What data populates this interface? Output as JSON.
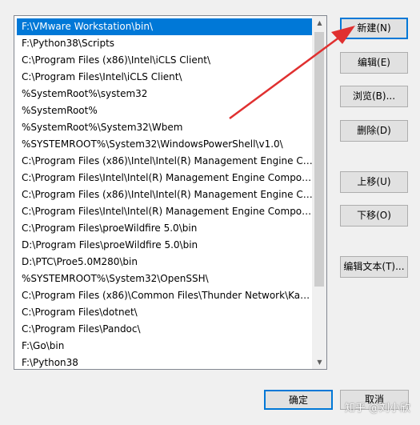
{
  "path_list": {
    "items": [
      "F:\\VMware Workstation\\bin\\",
      "F:\\Python38\\Scripts",
      "C:\\Program Files (x86)\\Intel\\iCLS Client\\",
      "C:\\Program Files\\Intel\\iCLS Client\\",
      "%SystemRoot%\\system32",
      "%SystemRoot%",
      "%SystemRoot%\\System32\\Wbem",
      "%SYSTEMROOT%\\System32\\WindowsPowerShell\\v1.0\\",
      "C:\\Program Files (x86)\\Intel\\Intel(R) Management Engine Co...",
      "C:\\Program Files\\Intel\\Intel(R) Management Engine Compon...",
      "C:\\Program Files (x86)\\Intel\\Intel(R) Management Engine Co...",
      "C:\\Program Files\\Intel\\Intel(R) Management Engine Compon...",
      "C:\\Program Files\\proeWildfire 5.0\\bin",
      "D:\\Program Files\\proeWildfire 5.0\\bin",
      "D:\\PTC\\Proe5.0M280\\bin",
      "%SYSTEMROOT%\\System32\\OpenSSH\\",
      "C:\\Program Files (x86)\\Common Files\\Thunder Network\\Kan...",
      "C:\\Program Files\\dotnet\\",
      "C:\\Program Files\\Pandoc\\",
      "F:\\Go\\bin",
      "F:\\Python38"
    ],
    "selected_index": 0
  },
  "buttons": {
    "new": "新建(N)",
    "edit": "编辑(E)",
    "browse": "浏览(B)...",
    "delete": "删除(D)",
    "move_up": "上移(U)",
    "move_down": "下移(O)",
    "edit_text": "编辑文本(T)...",
    "ok": "确定",
    "cancel": "取消"
  },
  "watermark": "知乎 @刘小欣",
  "colors": {
    "selection": "#0078d7",
    "annotation_arrow": "#e03030"
  },
  "icons": {
    "scroll_up": "scroll-up-arrow",
    "scroll_down": "scroll-down-arrow"
  }
}
